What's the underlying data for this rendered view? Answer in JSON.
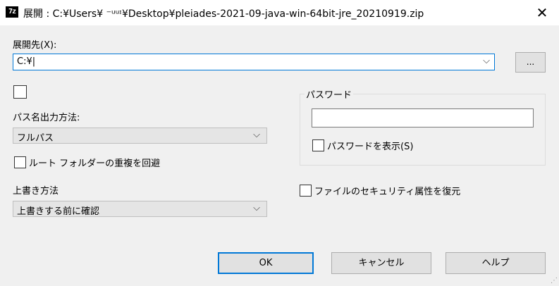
{
  "window": {
    "app_icon_text": "7z",
    "title": "展開 : C:¥Users¥ ⁻ᵘᵘᶦ¥Desktop¥pleiades-2021-09-java-win-64bit-jre_20210919.zip",
    "close_glyph": "✕"
  },
  "destination": {
    "label": "展開先(X):",
    "value": "C:¥|",
    "browse_label": "..."
  },
  "path_output": {
    "label": "パス名出力方法:",
    "selected": "フルパス"
  },
  "avoid_root_dup": {
    "label": "ルート フォルダーの重複を回避",
    "checked": false
  },
  "overwrite": {
    "label": "上書き方法",
    "selected": "上書きする前に確認"
  },
  "password": {
    "group_label": "パスワード",
    "value": "",
    "show_label": "パスワードを表示(S)",
    "show_checked": false
  },
  "restore_security": {
    "label": "ファイルのセキュリティ属性を復元",
    "checked": false
  },
  "buttons": {
    "ok": "OK",
    "cancel": "キャンセル",
    "help": "ヘルプ"
  },
  "icons": {
    "dropdown": "chevron-down-icon",
    "close": "close-icon"
  }
}
